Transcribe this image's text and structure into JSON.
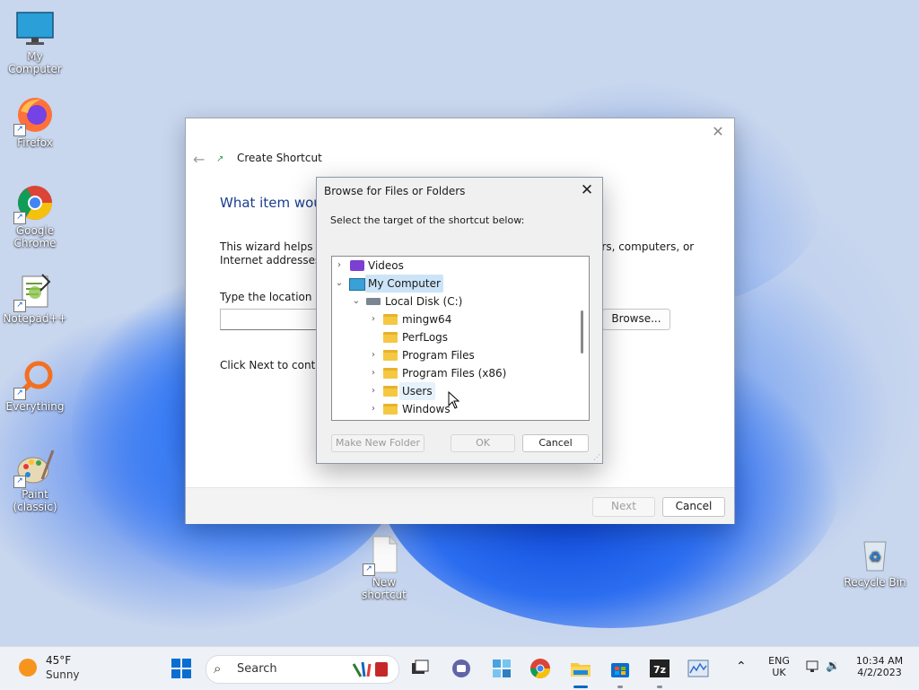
{
  "desktop": {
    "icons": [
      {
        "label": "My Computer"
      },
      {
        "label": "Firefox"
      },
      {
        "label": "Google Chrome"
      },
      {
        "label": "Notepad++"
      },
      {
        "label": "Everything"
      },
      {
        "label": "Paint (classic)"
      },
      {
        "label": "New shortcut"
      },
      {
        "label": "Recycle Bin"
      }
    ]
  },
  "wizard": {
    "title": "Create Shortcut",
    "heading": "What item woul",
    "description": "This wizard helps you                                                                                    ers, computers, or Internet addresses.",
    "desc_left": "This wizard helps you",
    "desc_right": "ers, computers, or",
    "desc_line2": "Internet addresses.",
    "location_label": "Type the location of t",
    "browse_label": "Browse...",
    "next_message": "Click Next to continu",
    "next_label": "Next",
    "cancel_label": "Cancel"
  },
  "browse_dialog": {
    "title": "Browse for Files or Folders",
    "instruction": "Select the target of the shortcut below:",
    "tree": [
      {
        "label": "Videos",
        "level": 0,
        "expander": "collapsed",
        "icon": "videos-icon"
      },
      {
        "label": "My Computer",
        "level": 0,
        "expander": "expanded",
        "icon": "computer-icon",
        "selected": true
      },
      {
        "label": "Local Disk (C:)",
        "level": 1,
        "expander": "expanded",
        "icon": "drive-icon"
      },
      {
        "label": "mingw64",
        "level": 2,
        "expander": "collapsed",
        "icon": "folder-icon"
      },
      {
        "label": "PerfLogs",
        "level": 2,
        "expander": "none",
        "icon": "folder-icon"
      },
      {
        "label": "Program Files",
        "level": 2,
        "expander": "collapsed",
        "icon": "folder-icon"
      },
      {
        "label": "Program Files (x86)",
        "level": 2,
        "expander": "collapsed",
        "icon": "folder-icon"
      },
      {
        "label": "Users",
        "level": 2,
        "expander": "collapsed",
        "icon": "folder-icon",
        "hovered": true
      },
      {
        "label": "Windows",
        "level": 2,
        "expander": "collapsed",
        "icon": "folder-icon"
      }
    ],
    "make_folder_label": "Make New Folder",
    "ok_label": "OK",
    "cancel_label": "Cancel"
  },
  "taskbar": {
    "weather_temp": "45°F",
    "weather_condition": "Sunny",
    "search_placeholder": "Search",
    "lang_line1": "ENG",
    "lang_line2": "UK",
    "time": "10:34 AM",
    "date": "4/2/2023"
  },
  "colors": {
    "accent": "#0067c0",
    "selection": "#cce4f7",
    "folder": "#f5c842"
  }
}
